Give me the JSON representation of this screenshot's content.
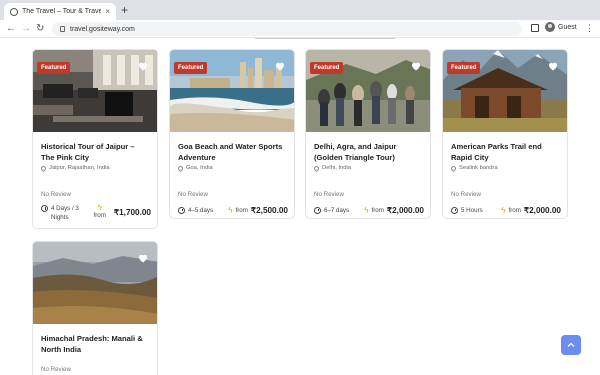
{
  "browser": {
    "tab_title": "The Travel – Tour & Travels W",
    "tab_close": "×",
    "new_tab": "+",
    "url": "travel.gositeway.com",
    "profile": "Guest"
  },
  "cards": [
    {
      "badge": "Featured",
      "title": "Historical Tour of Jaipur – The Pink City",
      "location": "Jaipur, Rajasthan, India",
      "review": "No Review",
      "duration": "4 Days / 3 Nights",
      "from": "from",
      "price": "₹1,700.00"
    },
    {
      "badge": "Featured",
      "title": "Goa Beach and Water Sports Adventure",
      "location": "Goa, India",
      "review": "No Review",
      "duration": "4–5 days",
      "from": "from",
      "price": "₹2,500.00"
    },
    {
      "badge": "Featured",
      "title": "Delhi, Agra, and Jaipur (Golden Triangle Tour)",
      "location": "Delhi, India",
      "review": "No Review",
      "duration": "6–7 days",
      "from": "from",
      "price": "₹2,000.00"
    },
    {
      "badge": "Featured",
      "title": "American Parks Trail end Rapid City",
      "location": "Sealink bandra",
      "review": "No Review",
      "duration": "5 Hours",
      "from": "from",
      "price": "₹2,000.00"
    },
    {
      "title": "Himachal Pradesh: Manali & North India",
      "review": "No Review"
    }
  ]
}
